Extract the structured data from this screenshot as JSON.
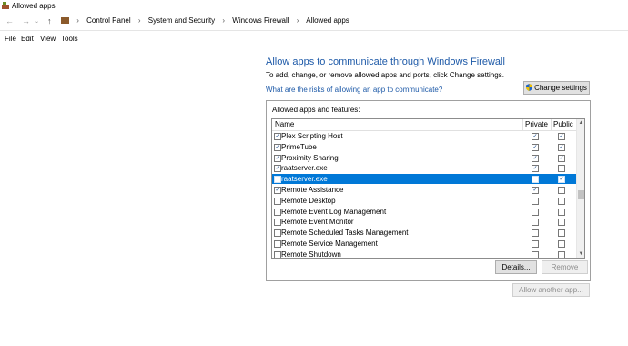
{
  "window": {
    "title": "Allowed apps"
  },
  "breadcrumb": [
    "Control Panel",
    "System and Security",
    "Windows Firewall",
    "Allowed apps"
  ],
  "menu": [
    "File",
    "Edit",
    "View",
    "Tools"
  ],
  "main": {
    "heading": "Allow apps to communicate through Windows Firewall",
    "subtext": "To add, change, or remove allowed apps and ports, click Change settings.",
    "risk_link": "What are the risks of allowing an app to communicate?",
    "change_settings": "Change settings"
  },
  "allowed": {
    "title": "Allowed apps and features:",
    "columns": {
      "name": "Name",
      "private": "Private",
      "public": "Public"
    },
    "rows": [
      {
        "name": "Plex Scripting Host",
        "enabled": true,
        "private": true,
        "public": true,
        "selected": false
      },
      {
        "name": "PrimeTube",
        "enabled": true,
        "private": true,
        "public": true,
        "selected": false
      },
      {
        "name": "Proximity Sharing",
        "enabled": true,
        "private": true,
        "public": true,
        "selected": false
      },
      {
        "name": "raatserver.exe",
        "enabled": true,
        "private": true,
        "public": false,
        "selected": false
      },
      {
        "name": "raatserver.exe",
        "enabled": false,
        "private": false,
        "public": true,
        "selected": true
      },
      {
        "name": "Remote Assistance",
        "enabled": true,
        "private": true,
        "public": false,
        "selected": false
      },
      {
        "name": "Remote Desktop",
        "enabled": false,
        "private": false,
        "public": false,
        "selected": false
      },
      {
        "name": "Remote Event Log Management",
        "enabled": false,
        "private": false,
        "public": false,
        "selected": false
      },
      {
        "name": "Remote Event Monitor",
        "enabled": false,
        "private": false,
        "public": false,
        "selected": false
      },
      {
        "name": "Remote Scheduled Tasks Management",
        "enabled": false,
        "private": false,
        "public": false,
        "selected": false
      },
      {
        "name": "Remote Service Management",
        "enabled": false,
        "private": false,
        "public": false,
        "selected": false
      },
      {
        "name": "Remote Shutdown",
        "enabled": false,
        "private": false,
        "public": false,
        "selected": false
      }
    ],
    "details_button": "Details...",
    "remove_button": "Remove"
  },
  "allow_another": "Allow another app...",
  "colors": {
    "accent": "#1e5aa8",
    "selection": "#0078d7"
  }
}
